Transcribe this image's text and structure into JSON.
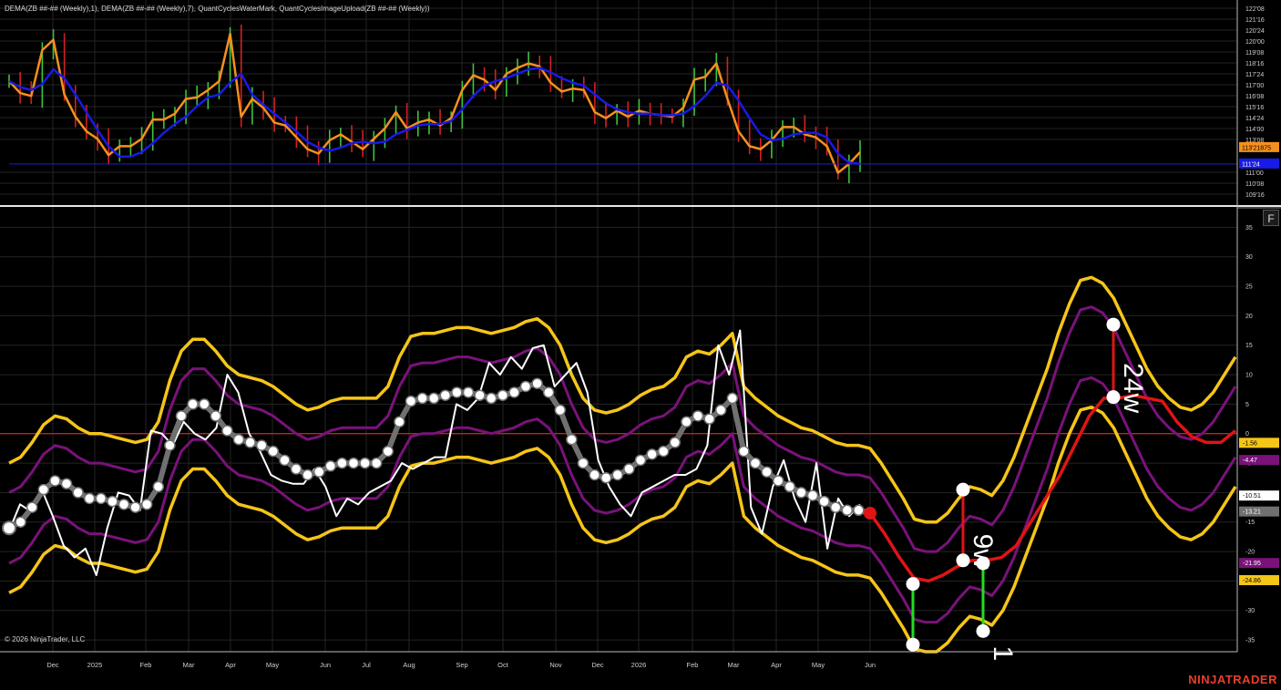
{
  "chart": {
    "indicator_title": "DEMA(ZB ##-## (Weekly),1), DEMA(ZB ##-## (Weekly),7), QuantCyclesWaterMark, QuantCyclesImageUpload(ZB ##-## (Weekly))",
    "copyright": "© 2026 NinjaTrader, LLC",
    "brand": "NINJATRADER",
    "f_button": "F"
  },
  "colors": {
    "background": "#000000",
    "grid": "#242424",
    "bar_up": "#3cc43c",
    "bar_down": "#d42020",
    "dema1": "#f5901e",
    "dema7": "#1a1ae6",
    "price_line": "#1a1ae6",
    "cycle_white": "#ffffff",
    "cycle_gray": "#707070",
    "band_outer": "#f5c518",
    "band_inner": "#7a127a",
    "projection": "#e01414",
    "zero_line": "#c02020",
    "marker_red": "#e01414",
    "marker_green": "#22dd22"
  },
  "chart_data": [
    {
      "type": "line",
      "panel": "price",
      "title": "",
      "x": [
        "Dec",
        "2025",
        "Feb",
        "Mar",
        "Apr",
        "May",
        "Jun",
        "Jul",
        "Aug",
        "Sep",
        "Oct",
        "Nov",
        "Dec",
        "2026",
        "Feb",
        "Mar",
        "Apr",
        "May",
        "Jun"
      ],
      "y_tick_labels": [
        "122'08",
        "121'16",
        "120'24",
        "120'00",
        "119'08",
        "118'16",
        "117'24",
        "117'00",
        "116'08",
        "115'16",
        "114'24",
        "114'00",
        "113'08",
        "111'00",
        "110'08",
        "109'16"
      ],
      "ylim": [
        109.2,
        122.4
      ],
      "series": [
        {
          "name": "DEMA(ZB ##-## (Weekly),1)",
          "values": [
            117.4,
            116.6,
            116.4,
            119.5,
            120.2,
            116.5,
            115.0,
            114.0,
            113.5,
            112.4,
            113.0,
            113.0,
            113.5,
            114.8,
            114.8,
            115.2,
            116.2,
            116.3,
            116.8,
            117.4,
            120.6,
            115.0,
            116.2,
            115.6,
            114.6,
            114.4,
            113.6,
            112.8,
            112.5,
            113.4,
            113.8,
            113.3,
            112.8,
            113.5,
            114.2,
            115.3,
            114.2,
            114.6,
            114.8,
            114.4,
            114.9,
            116.8,
            117.8,
            117.5,
            116.8,
            117.9,
            118.3,
            118.6,
            118.4,
            117.3,
            116.7,
            116.9,
            116.8,
            115.3,
            114.9,
            115.4,
            115.0,
            115.4,
            115.2,
            115.1,
            115.0,
            115.6,
            117.5,
            117.7,
            118.6,
            116.2,
            114.0,
            113.0,
            112.8,
            113.4,
            114.3,
            114.3,
            113.8,
            113.6,
            113.0,
            111.2,
            111.8,
            112.6
          ]
        },
        {
          "name": "DEMA(ZB ##-## (Weekly),7)",
          "values": [
            117.4,
            117.0,
            116.8,
            117.2,
            118.2,
            117.6,
            116.5,
            115.3,
            114.1,
            113.0,
            112.3,
            112.3,
            112.6,
            113.2,
            113.9,
            114.5,
            115.0,
            115.7,
            116.3,
            116.5,
            117.3,
            117.9,
            116.5,
            115.8,
            115.2,
            114.6,
            114.0,
            113.3,
            112.9,
            112.7,
            112.9,
            113.2,
            113.3,
            113.2,
            113.3,
            113.8,
            114.1,
            114.4,
            114.5,
            114.5,
            114.7,
            115.5,
            116.4,
            117.1,
            117.4,
            117.6,
            117.9,
            118.2,
            118.3,
            118.0,
            117.6,
            117.3,
            117.1,
            116.5,
            115.9,
            115.5,
            115.3,
            115.2,
            115.2,
            115.1,
            115.1,
            115.2,
            115.7,
            116.4,
            117.3,
            117.1,
            116.1,
            114.9,
            113.8,
            113.4,
            113.5,
            113.8,
            113.9,
            113.9,
            113.6,
            112.5,
            111.9,
            111.8
          ]
        }
      ],
      "price_markers": [
        {
          "label": "113'21875",
          "color": "#f5901e"
        },
        {
          "label": "111'24",
          "color": "#1a1ae6"
        }
      ]
    },
    {
      "type": "line",
      "panel": "cycles",
      "title": "",
      "y_ticks": [
        35,
        30,
        25,
        20,
        15,
        10,
        5,
        0,
        -5,
        -10,
        -15,
        -20,
        -25,
        -30,
        -35
      ],
      "ylim": [
        -37,
        38
      ],
      "series": [
        {
          "name": "",
          "values": [
            -16.5,
            -12.0,
            -13.2,
            -9.5,
            -14.0,
            -19.0,
            -21.0,
            -19.5,
            -24.0,
            -16.0,
            -10.0,
            -10.5,
            -13.0,
            0.5,
            0.0,
            -2.0,
            2.0,
            0.0,
            -1.0,
            1.0,
            10.0,
            7.0,
            0.0,
            -3.0,
            -7.0,
            -8.0,
            -8.5,
            -8.5,
            -6.0,
            -9.0,
            -14.0,
            -11.0,
            -12.0,
            -10.0,
            -9.0,
            -8.0,
            -5.0,
            -6.0,
            -5.0,
            -4.0,
            -4.0,
            5.0,
            4.0,
            6.0,
            12.0,
            10.0,
            13.0,
            11.0,
            14.5,
            15.0,
            8.0,
            10.0,
            12.0,
            7.0,
            -4.5,
            -9.0,
            -12.0,
            -14.0,
            -10.0,
            -9.0,
            -8.0,
            -7.0,
            -7.0,
            -6.0,
            -2.0,
            15.0,
            10.0,
            17.5,
            -12.5,
            -17.0,
            -9.0,
            -4.5,
            -11.0,
            -15.0,
            -5.0,
            -19.5,
            -11.0,
            -14.0,
            -12.0
          ]
        },
        {
          "name": "",
          "values": [
            -16.0,
            -15.0,
            -12.5,
            -9.5,
            -8.0,
            -8.5,
            -10.0,
            -11.0,
            -11.0,
            -11.5,
            -12.0,
            -12.5,
            -12.0,
            -9.0,
            -2.0,
            3.0,
            5.0,
            5.0,
            3.0,
            0.5,
            -1.0,
            -1.5,
            -2.0,
            -3.0,
            -4.5,
            -6.0,
            -7.0,
            -6.5,
            -5.5,
            -5.0,
            -5.0,
            -5.0,
            -5.0,
            -3.0,
            2.0,
            5.5,
            6.0,
            6.0,
            6.5,
            7.0,
            7.0,
            6.5,
            6.0,
            6.5,
            7.0,
            8.0,
            8.5,
            7.0,
            4.0,
            -1.0,
            -5.0,
            -7.0,
            -7.5,
            -7.0,
            -6.0,
            -4.5,
            -3.5,
            -3.0,
            -1.5,
            2.0,
            3.0,
            2.5,
            4.0,
            6.0,
            -3.0,
            -5.0,
            -6.5,
            -8.0,
            -9.0,
            -10.0,
            -10.5,
            -11.5,
            -12.5,
            -13.0,
            -13.0,
            -13.5
          ]
        },
        {
          "name": "",
          "values": [
            -13.0,
            -13.0,
            -19.0,
            -25.5,
            -26.0,
            -26.5,
            -22.0,
            -19.5,
            -20.0,
            -20.5,
            -22.0,
            -10.0,
            -3.0,
            15.0,
            18.5,
            17.0,
            16.0,
            16.0,
            16.0,
            14.0,
            10.0,
            5.0,
            0.0,
            -5.0,
            -5.0,
            -4.5,
            -3.0,
            -3.0,
            -2.0,
            7.0,
            12.0,
            16.0,
            18.0,
            18.0,
            17.0,
            16.0,
            15.0,
            15.0,
            13.0,
            -2.0,
            -8.0,
            -8.0,
            -12.0
          ]
        }
      ],
      "marker_labels": [
        "24w",
        "9w",
        "1"
      ],
      "value_flags": [
        {
          "label": "-1.56",
          "color": "#f5c518"
        },
        {
          "label": "-4.47",
          "color": "#7a127a"
        },
        {
          "label": "-10.51",
          "color": "#ffffff"
        },
        {
          "label": "-13.21",
          "color": "#707070"
        },
        {
          "label": "-21.95",
          "color": "#7a127a"
        },
        {
          "label": "-24.86",
          "color": "#f5c518"
        }
      ]
    }
  ]
}
